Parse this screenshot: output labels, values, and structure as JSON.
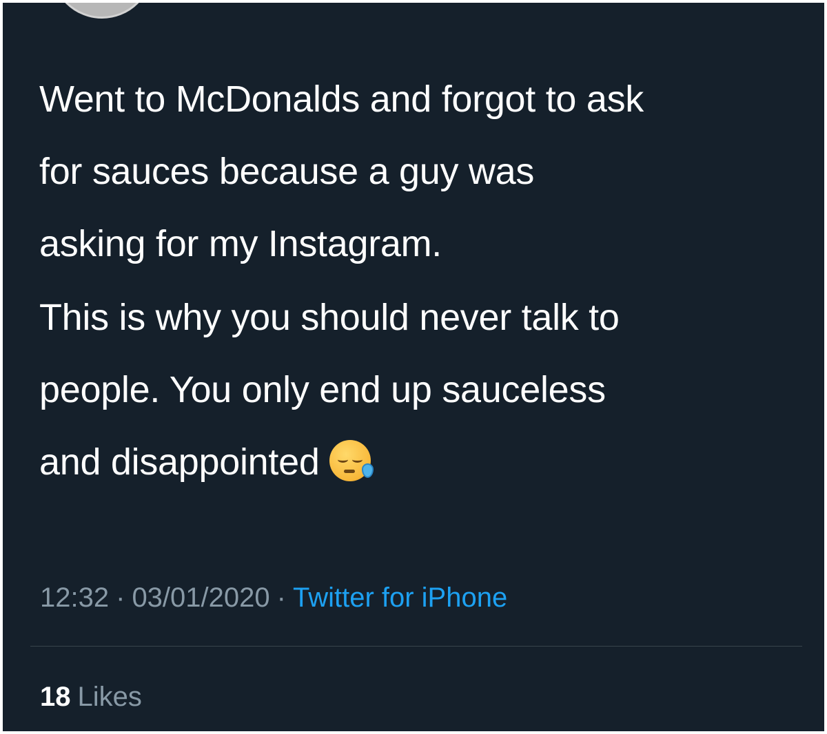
{
  "tweet": {
    "paragraphs": [
      {
        "lines": [
          "Went to McDonalds and forgot to ask",
          "for sauces because a guy was",
          "asking for my Instagram."
        ]
      },
      {
        "lines": [
          "This is why you should never talk to",
          "people. You only end up sauceless",
          "and disappointed"
        ]
      }
    ],
    "emoji": "sleepy-face-emoji"
  },
  "meta": {
    "time": "12:32",
    "separator": "·",
    "date": "03/01/2020",
    "source": "Twitter for iPhone"
  },
  "stats": {
    "likes_count": "18",
    "likes_label": "Likes"
  },
  "colors": {
    "background": "#15202b",
    "text": "#ffffff",
    "muted": "#8899a6",
    "link": "#1da1f2"
  }
}
